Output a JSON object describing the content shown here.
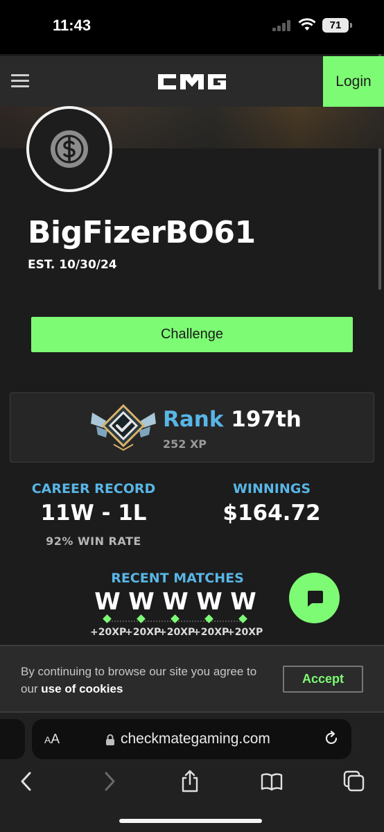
{
  "status_bar": {
    "time": "11:43",
    "battery": "71"
  },
  "nav": {
    "logo_text": "CMG",
    "login_label": "Login"
  },
  "profile": {
    "username": "BigFizerBO61",
    "established": "EST. 10/30/24",
    "avatar_icon": "dollar-icon"
  },
  "actions": {
    "challenge_label": "Challenge"
  },
  "rank": {
    "word": "Rank",
    "value": "197th",
    "xp": "252 XP"
  },
  "stats": {
    "career_label": "CAREER RECORD",
    "career_value": "11W - 1L",
    "win_rate": "92% WIN RATE",
    "winnings_label": "WINNINGS",
    "winnings_value": "$164.72"
  },
  "recent": {
    "label": "RECENT MATCHES",
    "matches": [
      {
        "result": "W",
        "xp": "+20XP"
      },
      {
        "result": "W",
        "xp": "+20XP"
      },
      {
        "result": "W",
        "xp": "+20XP"
      },
      {
        "result": "W",
        "xp": "+20XP"
      },
      {
        "result": "W",
        "xp": "+20XP"
      }
    ]
  },
  "cookie": {
    "text": "By continuing to browse our site you agree to our ",
    "link": "use of cookies",
    "accept_label": "Accept"
  },
  "browser": {
    "aa_label": "AA",
    "url": "checkmategaming.com"
  },
  "colors": {
    "accent_green": "#7dfb74",
    "accent_blue": "#58b6e6",
    "background": "#1c1c1c"
  }
}
